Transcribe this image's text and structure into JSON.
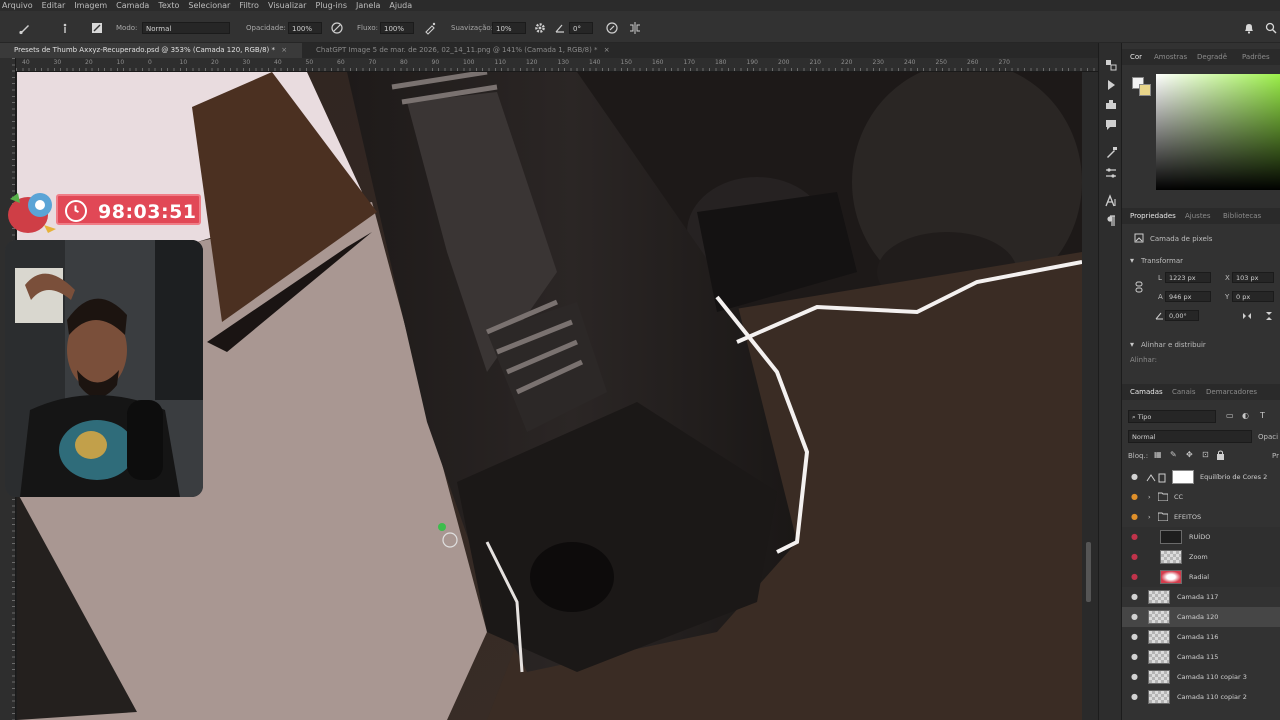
{
  "menu": [
    "Arquivo",
    "Editar",
    "Imagem",
    "Camada",
    "Texto",
    "Selecionar",
    "Filtro",
    "Visualizar",
    "Plug-ins",
    "Janela",
    "Ajuda"
  ],
  "options": {
    "mode_label": "Modo:",
    "mode_value": "Normal",
    "opacity_label": "Opacidade:",
    "opacity_value": "100%",
    "flow_label": "Fluxo:",
    "flow_value": "100%",
    "smoothing_label": "Suavização:",
    "smoothing_value": "10%",
    "angle_value": "0°"
  },
  "tabs": [
    {
      "label": "Presets de Thumb Axxyz-Recuperado.psd @ 353% (Camada 120, RGB/8) *"
    },
    {
      "label": "ChatGPT Image 5 de mar. de 2026, 02_14_11.png @ 141% (Camada 1, RGB/8) *"
    }
  ],
  "ruler_top": [
    "40",
    "30",
    "20",
    "10",
    "0",
    "10",
    "20",
    "30",
    "40",
    "50",
    "60",
    "70",
    "80",
    "90",
    "100",
    "110",
    "120",
    "130",
    "140",
    "150",
    "160",
    "170",
    "180",
    "190",
    "200",
    "210",
    "220",
    "230",
    "240",
    "250",
    "260",
    "270"
  ],
  "timer": {
    "value": "98:03:51",
    "color": "#e14856"
  },
  "panel": {
    "color_tabs": [
      "Cor",
      "Amostras",
      "Degradê",
      "Padrões"
    ],
    "props_tabs": [
      "Propriedades",
      "Ajustes",
      "Bibliotecas"
    ],
    "pixel_layer": "Camada de pixels",
    "transform_title": "Transformar",
    "w_label": "L",
    "w_value": "1223 px",
    "x_label": "X",
    "x_value": "103 px",
    "h_label": "A",
    "h_value": "946 px",
    "y_label": "Y",
    "y_value": "0 px",
    "angle_value": "0,00°",
    "align_title": "Alinhar e distribuir",
    "align_label": "Alinhar:",
    "layers_tabs": [
      "Camadas",
      "Canais",
      "Demarcadores"
    ],
    "filter_value": "Tipo",
    "blend_value": "Normal",
    "opacity_label": "Opaci",
    "lock_label": "Bloq.:",
    "fill_label": "Pr"
  },
  "layers": [
    {
      "name": "Equilíbrio de Cores 2",
      "eye": "white",
      "type": "adjust"
    },
    {
      "name": "CC",
      "eye": "orange",
      "type": "group"
    },
    {
      "name": "EFEITOS",
      "eye": "orange",
      "type": "group"
    },
    {
      "name": "RUÍDO",
      "eye": "red",
      "type": "dark"
    },
    {
      "name": "Zoom",
      "eye": "red",
      "type": "pixel"
    },
    {
      "name": "Radial",
      "eye": "red",
      "type": "radial"
    },
    {
      "name": "Camada 117",
      "eye": "white",
      "type": "pixel"
    },
    {
      "name": "Camada 120",
      "eye": "white",
      "type": "pixel",
      "selected": true
    },
    {
      "name": "Camada 116",
      "eye": "white",
      "type": "pixel"
    },
    {
      "name": "Camada 115",
      "eye": "white",
      "type": "pixel"
    },
    {
      "name": "Camada 110 copiar 3",
      "eye": "white",
      "type": "pixel"
    },
    {
      "name": "Camada 110 copiar 2",
      "eye": "white",
      "type": "pixel"
    }
  ]
}
